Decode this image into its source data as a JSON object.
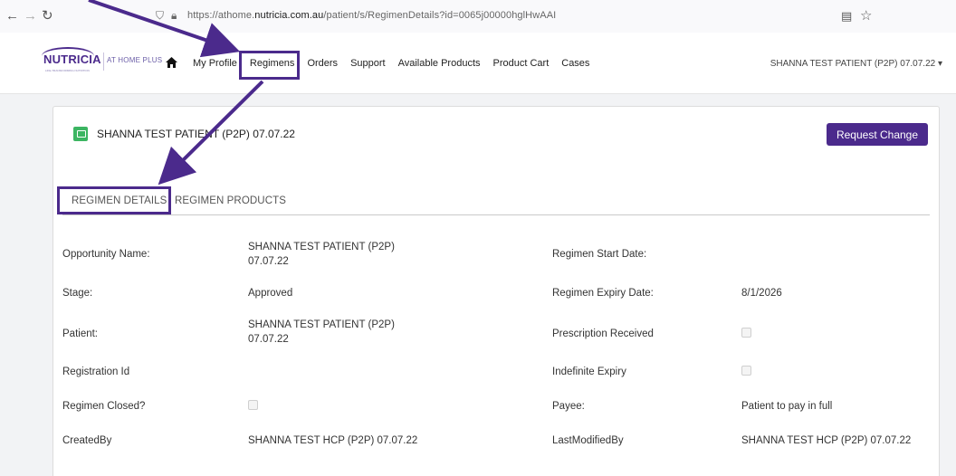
{
  "browser": {
    "url_prefix": "https://athome.",
    "url_domain": "nutricia.com.au",
    "url_path": "/patient/s/RegimenDetails?id=0065j00000hglHwAAI"
  },
  "site": {
    "logo_text": "NUTRICIA",
    "logo_sub": "AT HOME PLUS",
    "logo_tag": "LIFE-TRANSFORMING NUTRITION",
    "nav": {
      "my_profile": "My Profile",
      "regimens": "Regimens",
      "orders": "Orders",
      "support": "Support",
      "available_products": "Available Products",
      "product_cart": "Product Cart",
      "cases": "Cases"
    },
    "user_menu": "SHANNA TEST PATIENT (P2P) 07.07.22 ▾"
  },
  "record": {
    "title": "SHANNA TEST PATIENT (P2P) 07.07.22",
    "request_change": "Request Change"
  },
  "tabs": {
    "details": "REGIMEN DETAILS",
    "products": "REGIMEN PRODUCTS"
  },
  "details": {
    "opportunity_name_label": "Opportunity Name:",
    "opportunity_name_value": "SHANNA TEST PATIENT (P2P) 07.07.22",
    "regimen_start_label": "Regimen Start Date:",
    "regimen_start_value": "",
    "stage_label": "Stage:",
    "stage_value": "Approved",
    "regimen_expiry_label": "Regimen Expiry Date:",
    "regimen_expiry_value": "8/1/2026",
    "patient_label": "Patient:",
    "patient_value": "SHANNA TEST PATIENT (P2P) 07.07.22",
    "prescription_label": "Prescription Received",
    "registration_label": "Registration Id",
    "registration_value": "",
    "indefinite_label": "Indefinite Expiry",
    "regimen_closed_label": "Regimen Closed?",
    "payee_label": "Payee:",
    "payee_value": "Patient to pay in full",
    "created_by_label": "CreatedBy",
    "created_by_value": "SHANNA TEST HCP (P2P) 07.07.22",
    "last_modified_label": "LastModifiedBy",
    "last_modified_value": "SHANNA TEST HCP (P2P) 07.07.22"
  },
  "colors": {
    "brand_purple": "#4b2a8c",
    "record_icon_green": "#3cb562"
  }
}
